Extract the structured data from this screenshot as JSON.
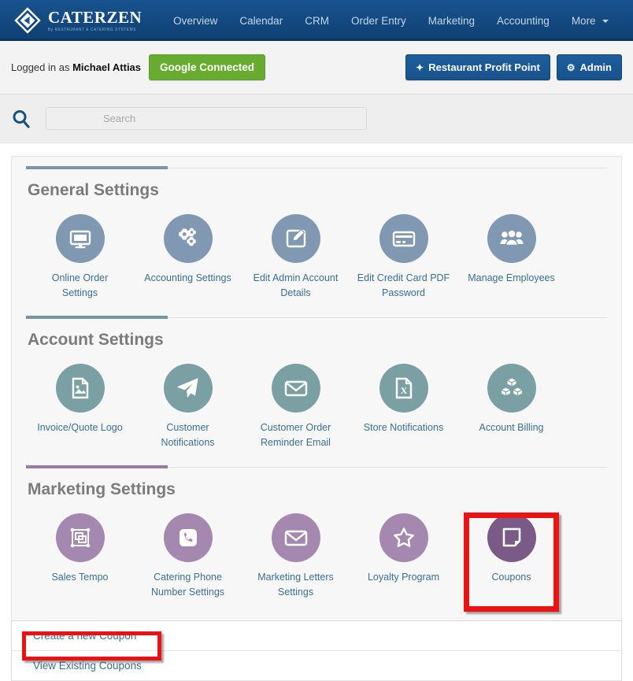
{
  "brand": {
    "name_part1": "C",
    "name": "CATERZEN",
    "tagline": "By RESTAURANT & CATERING SYSTEMS"
  },
  "nav": {
    "items": [
      {
        "label": "Overview"
      },
      {
        "label": "Calendar"
      },
      {
        "label": "CRM"
      },
      {
        "label": "Order Entry"
      },
      {
        "label": "Marketing"
      },
      {
        "label": "Accounting"
      },
      {
        "label": "More",
        "has_caret": true
      }
    ]
  },
  "userbar": {
    "logged_in_prefix": "Logged in as",
    "user_name": "Michael Attias",
    "google_button": "Google Connected",
    "profit_point_button": "Restaurant Profit Point",
    "admin_button": "Admin"
  },
  "search": {
    "placeholder": "Search",
    "value": ""
  },
  "sections": [
    {
      "title": "General Settings",
      "accent_color": "#7d93ad",
      "circle_color": "#8198b3",
      "tiles": [
        {
          "label": "Online Order Settings",
          "icon": "monitor-icon"
        },
        {
          "label": "Accounting Settings",
          "icon": "gears-icon"
        },
        {
          "label": "Edit Admin Account Details",
          "icon": "edit-square-icon"
        },
        {
          "label": "Edit Credit Card PDF Password",
          "icon": "credit-card-icon"
        },
        {
          "label": "Manage Employees",
          "icon": "users-icon"
        }
      ]
    },
    {
      "title": "Account Settings",
      "accent_color": "#6f9a9e",
      "circle_color": "#7ba0a4",
      "tiles": [
        {
          "label": "Invoice/Quote Logo",
          "icon": "image-file-icon"
        },
        {
          "label": "Customer Notifications",
          "icon": "paper-plane-icon"
        },
        {
          "label": "Customer Order Reminder Email",
          "icon": "envelope-icon"
        },
        {
          "label": "Store Notifications",
          "icon": "excel-file-icon"
        },
        {
          "label": "Account Billing",
          "icon": "boxes-icon"
        }
      ]
    },
    {
      "title": "Marketing Settings",
      "accent_color": "#9a7aa6",
      "circle_color": "#a588b0",
      "tiles": [
        {
          "label": "Sales Tempo",
          "icon": "crop-frame-icon"
        },
        {
          "label": "Catering Phone Number Settings",
          "icon": "phone-icon"
        },
        {
          "label": "Marketing Letters Settings",
          "icon": "envelope-icon"
        },
        {
          "label": "Loyalty Program",
          "icon": "star-icon"
        },
        {
          "label": "Coupons",
          "icon": "coupon-note-icon",
          "highlighted": true,
          "circle_color": "#7a5a86"
        }
      ]
    }
  ],
  "coupon_dropdown": {
    "items": [
      {
        "label": "Create a new Coupon",
        "highlighted": true
      },
      {
        "label": "View Existing Coupons",
        "highlighted": false
      }
    ]
  },
  "highlight_color": "#ee1111"
}
